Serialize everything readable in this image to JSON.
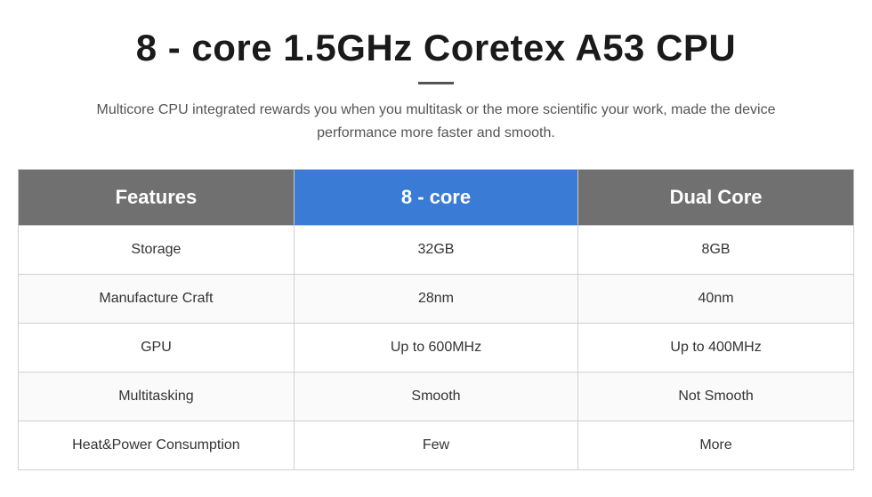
{
  "title": "8 - core 1.5GHz Coretex A53 CPU",
  "subtitle": "Multicore CPU integrated rewards you when you multitask or the more scientific your work, made the device performance more faster and smooth.",
  "table": {
    "headers": {
      "features": "Features",
      "col1": "8 - core",
      "col2": "Dual Core"
    },
    "rows": [
      {
        "feature": "Storage",
        "col1": "32GB",
        "col2": "8GB"
      },
      {
        "feature": "Manufacture Craft",
        "col1": "28nm",
        "col2": "40nm"
      },
      {
        "feature": "GPU",
        "col1": "Up to 600MHz",
        "col2": "Up to 400MHz"
      },
      {
        "feature": "Multitasking",
        "col1": "Smooth",
        "col2": "Not Smooth"
      },
      {
        "feature": "Heat&Power Consumption",
        "col1": "Few",
        "col2": "More"
      }
    ]
  }
}
